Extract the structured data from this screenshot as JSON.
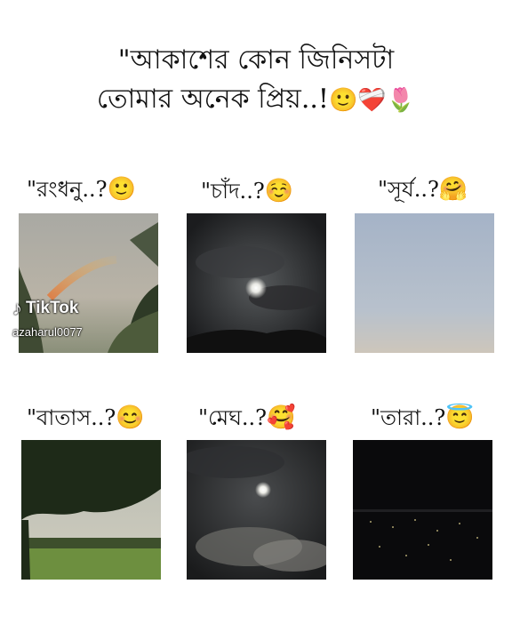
{
  "title": {
    "line1": "\"আকাশের কোন জিনিসটা",
    "line2": "তোমার অনেক প্রিয়..!",
    "line2_emojis": "🙂❤️‍🩹🌷"
  },
  "items": [
    {
      "label": "\"রংধনু..?",
      "emoji": "🙂"
    },
    {
      "label": "\"চাঁদ..?",
      "emoji": "☺️"
    },
    {
      "label": "\"সূর্য..?",
      "emoji": "🤗"
    },
    {
      "label": "\"বাতাস..?",
      "emoji": "😊"
    },
    {
      "label": "\"মেঘ..?",
      "emoji": "🥰"
    },
    {
      "label": "\"তারা..?",
      "emoji": "😇"
    }
  ],
  "watermark": {
    "brand": "TikTok",
    "handle": "azaharul0077"
  },
  "colors": {
    "background": "#ffffff",
    "text": "#111111"
  }
}
